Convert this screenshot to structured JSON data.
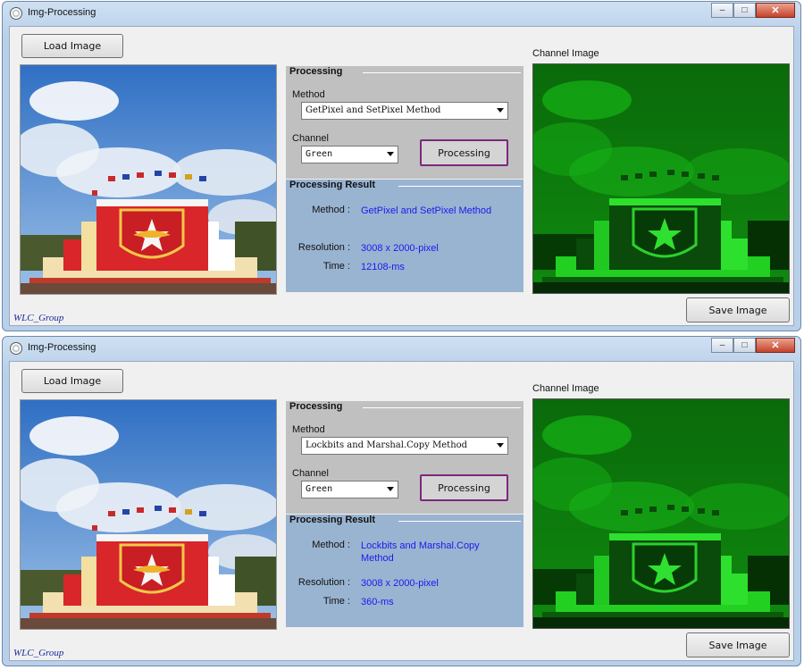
{
  "windows": [
    {
      "title": "Img-Processing",
      "controls": {
        "minimize": "–",
        "maximize": "□",
        "close": "✕"
      },
      "load_button": "Load Image",
      "processing_group": "Processing",
      "method_label": "Method",
      "method_value": "GetPixel and SetPixel Method",
      "channel_label": "Channel",
      "channel_value": "Green",
      "process_button": "Processing",
      "result_group": "Processing Result",
      "result": {
        "method_label": "Method :",
        "method_value": "GetPixel and SetPixel Method",
        "resolution_label": "Resolution :",
        "resolution_value": "3008 x 2000-pixel",
        "time_label": "Time :",
        "time_value": "12108-ms"
      },
      "channel_image_label": "Channel Image",
      "save_button": "Save Image",
      "group_name": "WLC_Group"
    },
    {
      "title": "Img-Processing",
      "controls": {
        "minimize": "–",
        "maximize": "□",
        "close": "✕"
      },
      "load_button": "Load Image",
      "processing_group": "Processing",
      "method_label": "Method",
      "method_value": "Lockbits and Marshal.Copy Method",
      "channel_label": "Channel",
      "channel_value": "Green",
      "process_button": "Processing",
      "result_group": "Processing Result",
      "result": {
        "method_label": "Method :",
        "method_value": "Lockbits and Marshal.Copy Method",
        "resolution_label": "Resolution :",
        "resolution_value": "3008 x 2000-pixel",
        "time_label": "Time :",
        "time_value": "360-ms"
      },
      "channel_image_label": "Channel Image",
      "save_button": "Save Image",
      "group_name": "WLC_Group"
    }
  ],
  "colors": {
    "processing_panel": "#c0c0c0",
    "result_panel": "#99b4d1",
    "result_value_text": "#1a1aee",
    "process_button_border": "#7a2a7a",
    "channel_green": "#1fd21f"
  },
  "icons": [
    "app-icon",
    "minimize-icon",
    "maximize-icon",
    "close-icon",
    "dropdown-arrow-icon"
  ]
}
